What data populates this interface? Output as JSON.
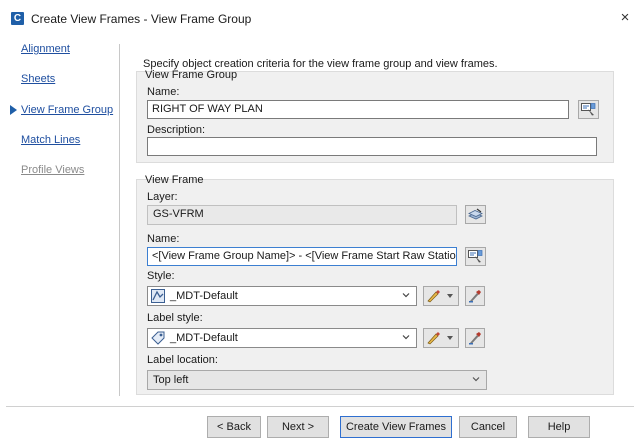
{
  "window": {
    "app_icon": "C",
    "title": "Create View Frames - View Frame Group",
    "close_glyph": "×"
  },
  "nav": {
    "items": [
      {
        "label": "Alignment",
        "state": "link"
      },
      {
        "label": "Sheets",
        "state": "link"
      },
      {
        "label": "View Frame Group",
        "state": "current"
      },
      {
        "label": "Match Lines",
        "state": "link"
      },
      {
        "label": "Profile Views",
        "state": "disabled"
      }
    ]
  },
  "main": {
    "instruction": "Specify object creation criteria for the view frame group and view frames.",
    "group": {
      "legend": "View Frame Group",
      "name_label": "Name:",
      "name_value": "RIGHT OF WAY PLAN",
      "description_label": "Description:",
      "description_value": ""
    },
    "frame": {
      "legend": "View Frame",
      "layer_label": "Layer:",
      "layer_value": "GS-VFRM",
      "name_label": "Name:",
      "name_value": "<[View Frame Group Name]> - <[View Frame Start Raw Station]>",
      "style_label": "Style:",
      "style_value": "_MDT-Default",
      "label_style_label": "Label style:",
      "label_style_value": "_MDT-Default",
      "label_location_label": "Label location:",
      "label_location_value": "Top left"
    }
  },
  "footer": {
    "back_label": "< Back",
    "next_label": "Next >",
    "create_label": "Create View Frames",
    "cancel_label": "Cancel",
    "help_label": "Help"
  },
  "colors": {
    "accent": "#1f5fa8",
    "link": "#1f4fa0",
    "panel_bg": "#f0f0f0",
    "focus_border": "#3c7fd1"
  },
  "icons": {
    "app": "civil3d-app-icon",
    "close": "close-icon",
    "current_step": "current-step-arrow-icon",
    "name_editor": "name-template-editor-icon",
    "layer": "layer-select-icon",
    "style_preview": "view-frame-style-icon",
    "label_style_preview": "label-style-icon",
    "style_edit": "edit-style-icon",
    "style_pick": "pick-style-icon",
    "dropdown": "chevron-down-icon"
  }
}
